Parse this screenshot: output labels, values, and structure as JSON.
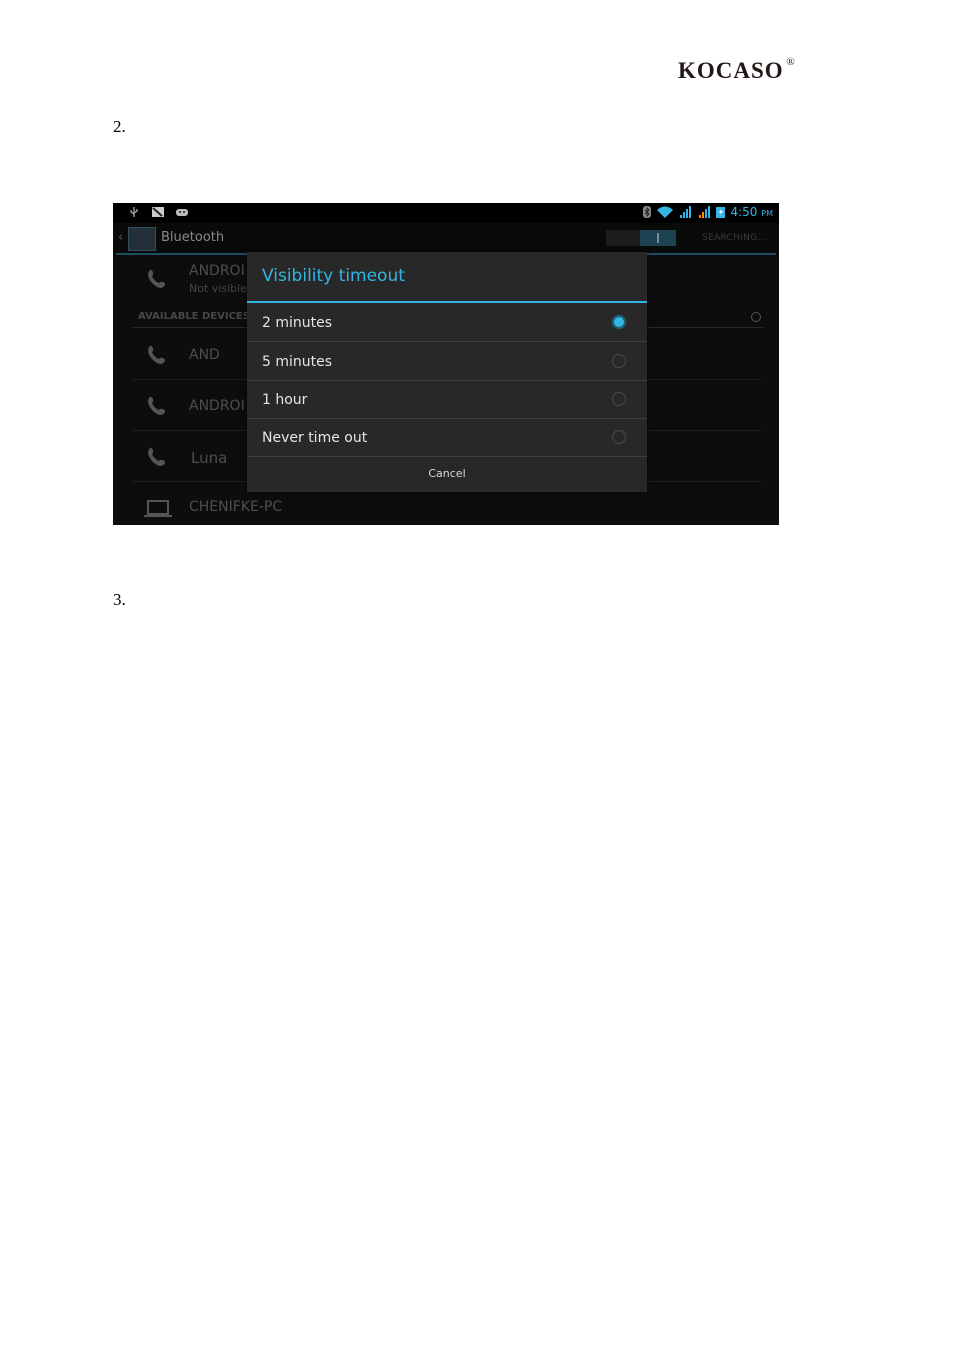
{
  "brand": {
    "name": "KOCASO",
    "registered_mark": "®"
  },
  "steps": [
    "2.",
    "3."
  ],
  "screenshot": {
    "status_bar": {
      "left_icons": [
        "usb-icon",
        "image-notification-icon",
        "android-debug-icon"
      ],
      "right_icons": [
        "bluetooth-icon",
        "wifi-icon",
        "signal-icon",
        "signal-icon",
        "battery-charging-icon"
      ],
      "time": "4:50",
      "ampm": "PM"
    },
    "action_bar": {
      "title": "Bluetooth",
      "toggle_state": "on",
      "status": "SEARCHING..."
    },
    "paired_device": {
      "name": "ANDROI",
      "subtitle": "Not visible"
    },
    "section_header": "AVAILABLE DEVICES",
    "devices": [
      {
        "name": "AND",
        "icon": "phone-icon"
      },
      {
        "name": "ANDROI",
        "icon": "phone-icon"
      },
      {
        "name": "Luna",
        "icon": "phone-icon"
      },
      {
        "name": "CHENIFKE-PC",
        "icon": "laptop-icon"
      }
    ],
    "dialog": {
      "title": "Visibility timeout",
      "options": [
        {
          "label": "2 minutes",
          "selected": true
        },
        {
          "label": "5 minutes",
          "selected": false
        },
        {
          "label": "1 hour",
          "selected": false
        },
        {
          "label": "Never time out",
          "selected": false
        }
      ],
      "cancel_label": "Cancel"
    },
    "accent_color": "#33b5e5"
  }
}
